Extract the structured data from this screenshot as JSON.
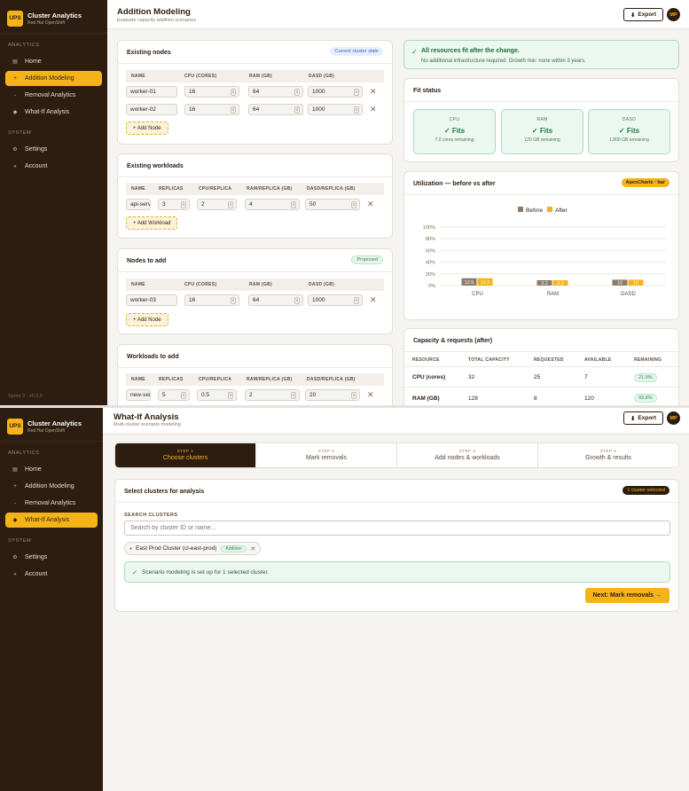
{
  "brand": {
    "logo": "UPS",
    "title": "Cluster Analytics",
    "subtitle": "Red Hat OpenShift"
  },
  "nav": {
    "analytics_label": "ANALYTICS",
    "system_label": "SYSTEM",
    "home": "Home",
    "addition": "Addition Modeling",
    "removal": "Removal Analytics",
    "whatif": "What-If Analysis",
    "settings": "Settings",
    "account": "Account",
    "icons": {
      "home": "home-icon",
      "addition": "plus-icon",
      "removal": "minus-icon",
      "whatif": "diamond-icon",
      "settings": "gear-icon",
      "account": "user-icon"
    }
  },
  "sprint": "Sprint 3 · v0.3.0",
  "header": {
    "export": "Export",
    "avatar": "MP"
  },
  "screen1": {
    "title": "Addition Modeling",
    "subtitle": "Evaluate capacity addition scenarios",
    "existing_nodes": {
      "title": "Existing nodes",
      "badge": "Current cluster state",
      "columns": [
        "NAME",
        "CPU (CORES)",
        "RAM (GB)",
        "DASD (GB)"
      ],
      "rows": [
        [
          "worker-01",
          "16",
          "64",
          "1000"
        ],
        [
          "worker-02",
          "16",
          "64",
          "1000"
        ]
      ],
      "add": "+ Add Node"
    },
    "existing_workloads": {
      "title": "Existing workloads",
      "columns": [
        "NAME",
        "REPLICAS",
        "CPU/REPLICA",
        "RAM/REPLICA (GB)",
        "DASD/REPLICA (GB)"
      ],
      "rows": [
        [
          "api-serv",
          "3",
          "2",
          "4",
          "50"
        ]
      ],
      "add": "+ Add Workload"
    },
    "nodes_to_add": {
      "title": "Nodes to add",
      "badge": "Proposed",
      "columns": [
        "NAME",
        "CPU (CORES)",
        "RAM (GB)",
        "DASD (GB)"
      ],
      "rows": [
        [
          "worker-03",
          "16",
          "64",
          "1000"
        ]
      ],
      "add": "+ Add Node"
    },
    "workloads_to_add": {
      "title": "Workloads to add",
      "columns": [
        "NAME",
        "REPLICAS",
        "CPU/REPLICA",
        "RAM/REPLICA (GB)",
        "DASD/REPLICA (GB)"
      ],
      "rows": [
        [
          "new-serv",
          "5",
          "0.5",
          "2",
          "20"
        ]
      ]
    },
    "alert": {
      "title": "All resources fit after the change.",
      "text": "No additional infrastructure required. Growth risk: none within 3 years."
    },
    "fit_status": {
      "title": "Fit status",
      "items": [
        {
          "label": "CPU",
          "value": "✓ Fits",
          "remaining": "7.0 cores remaining"
        },
        {
          "label": "RAM",
          "value": "✓ Fits",
          "remaining": "120 GB remaining"
        },
        {
          "label": "DASD",
          "value": "✓ Fits",
          "remaining": "1,800 GB remaining"
        }
      ]
    },
    "utilization": {
      "title": "Utilization — before vs after",
      "badge": "ApexCharts · bar"
    },
    "capacity": {
      "title": "Capacity & requests (after)",
      "columns": [
        "RESOURCE",
        "TOTAL CAPACITY",
        "REQUESTED",
        "AVAILABLE",
        "REMAINING"
      ],
      "rows": [
        [
          "CPU (cores)",
          "32",
          "25",
          "7",
          "21.9%"
        ],
        [
          "RAM (GB)",
          "128",
          "8",
          "120",
          "93.8%"
        ]
      ]
    }
  },
  "screen2": {
    "title": "What-If Analysis",
    "subtitle": "Multi-cluster scenario modeling",
    "steps": [
      {
        "num": "STEP 1",
        "label": "Choose clusters"
      },
      {
        "num": "STEP 2",
        "label": "Mark removals"
      },
      {
        "num": "STEP 3",
        "label": "Add nodes & workloads"
      },
      {
        "num": "STEP 4",
        "label": "Growth & results"
      }
    ],
    "select": {
      "title": "Select clusters for analysis",
      "badge": "1 cluster selected",
      "search_label": "SEARCH CLUSTERS",
      "search_placeholder": "Search by cluster ID or name...",
      "chip": "East Prod Cluster (cl-east-prod)",
      "chip_badge": "Addition",
      "info": "Scenario modeling is set up for 1 selected cluster.",
      "next": "Next: Mark removals →"
    }
  },
  "chart_data": {
    "type": "bar",
    "title": "Utilization — before vs after",
    "categories": [
      "CPU",
      "RAM",
      "DASD"
    ],
    "series": [
      {
        "name": "Before",
        "values": [
          12.5,
          3.2,
          10
        ]
      },
      {
        "name": "After",
        "values": [
          12.5,
          3.2,
          10
        ]
      }
    ],
    "data_labels": [
      [
        "12.5",
        "3.2",
        "10"
      ],
      [
        "12.5",
        "3.2",
        "10"
      ]
    ],
    "y_ticks": [
      "100%",
      "80%",
      "60%",
      "40%",
      "20%",
      "0%"
    ],
    "ylim": [
      0,
      100
    ],
    "legend": "top-center",
    "colors": {
      "Before": "#8b7b6b",
      "After": "#f5b31a"
    },
    "grid": true
  }
}
